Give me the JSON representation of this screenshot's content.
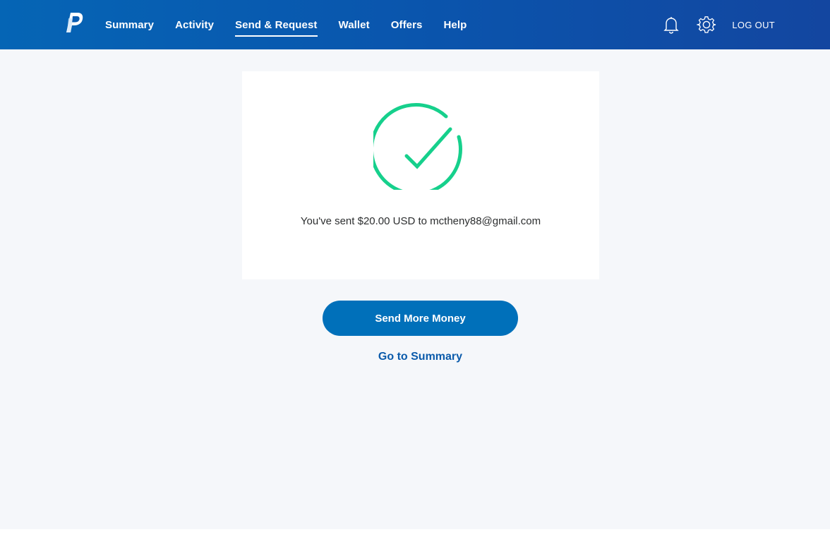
{
  "header": {
    "logo_icon": "paypal-logo-icon",
    "nav": [
      {
        "label": "Summary",
        "active": false
      },
      {
        "label": "Activity",
        "active": false
      },
      {
        "label": "Send & Request",
        "active": true
      },
      {
        "label": "Wallet",
        "active": false
      },
      {
        "label": "Offers",
        "active": false
      },
      {
        "label": "Help",
        "active": false
      }
    ],
    "notifications_icon": "bell-icon",
    "settings_icon": "gear-icon",
    "logout_label": "LOG OUT"
  },
  "confirmation": {
    "icon": "checkmark-circle-icon",
    "message": "You've sent $20.00 USD to mctheny88@gmail.com"
  },
  "actions": {
    "send_more_label": "Send More Money",
    "summary_link_label": "Go to Summary"
  },
  "colors": {
    "header_start": "#0565b5",
    "header_end": "#1346a0",
    "success_green": "#16d08c",
    "button_blue": "#0070ba",
    "link_blue": "#0b5bab",
    "background": "#f5f7fa"
  }
}
